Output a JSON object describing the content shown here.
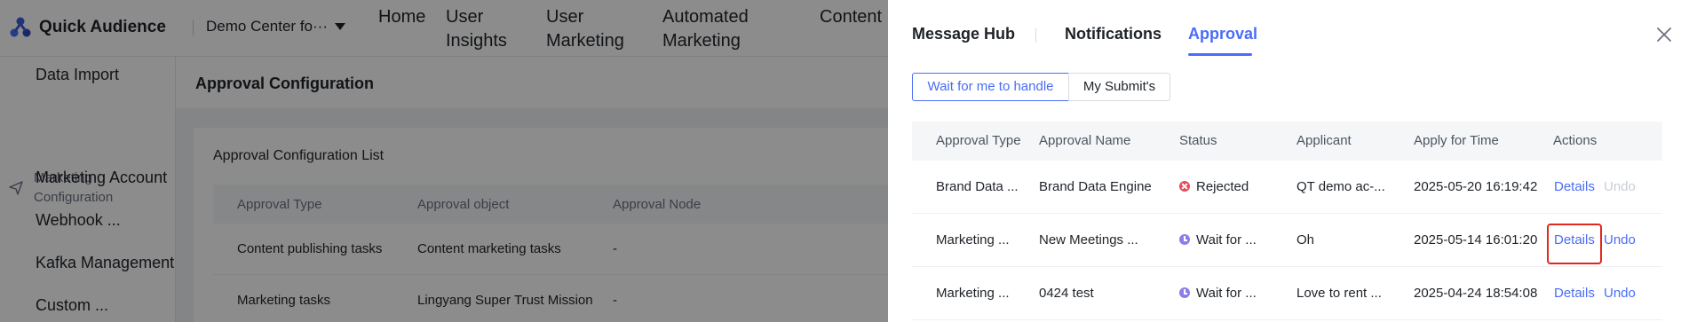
{
  "app": {
    "name": "Quick Audience",
    "org": "Demo Center fo···",
    "nav": [
      "Home",
      "User\nInsights",
      "User\nMarketing",
      "Automated\nMarketing",
      "Content"
    ],
    "sidebar": {
      "top_item": "Data Import",
      "group_label": "Marketing Configuration",
      "items": [
        "Marketing Account",
        "Webhook ...",
        "Kafka Management",
        "Custom ..."
      ]
    },
    "page_title": "Approval Configuration",
    "card_title": "Approval Configuration List",
    "table": {
      "headers": [
        "Approval Type",
        "Approval object",
        "Approval Node"
      ],
      "rows": [
        [
          "Content publishing tasks",
          "Content marketing tasks",
          "-"
        ],
        [
          "Marketing tasks",
          "Lingyang Super Trust Mission",
          "-"
        ]
      ]
    }
  },
  "drawer": {
    "tabs": [
      "Message Hub",
      "Notifications",
      "Approval"
    ],
    "active_tab": "Approval",
    "close_icon": "close-icon",
    "segments": [
      "Wait for me to handle",
      "My Submit's"
    ],
    "active_segment": "Wait for me to handle",
    "headers": [
      "Approval Type",
      "Approval Name",
      "Status",
      "Applicant",
      "Apply for Time",
      "Actions"
    ],
    "rows": [
      {
        "type": "Brand Data ...",
        "name": "Brand Data Engine",
        "status": "Rejected",
        "status_kind": "rejected",
        "applicant": "QT demo ac-...",
        "time": "2025-05-20 16:19:42",
        "details": "Details",
        "undo": "Undo",
        "undo_enabled": false
      },
      {
        "type": "Marketing ...",
        "name": "New Meetings ...",
        "status": "Wait for ...",
        "status_kind": "wait",
        "applicant": "Oh",
        "time": "2025-05-14 16:01:20",
        "details": "Details",
        "undo": "Undo",
        "undo_enabled": true
      },
      {
        "type": "Marketing ...",
        "name": "0424 test",
        "status": "Wait for ...",
        "status_kind": "wait",
        "applicant": "Love to rent ...",
        "time": "2025-04-24 18:54:08",
        "details": "Details",
        "undo": "Undo",
        "undo_enabled": true
      }
    ]
  },
  "colors": {
    "accent": "#4a6cf7",
    "rejected": "#e34d59",
    "waiting": "#8b7ee8",
    "highlight": "#e0291c"
  }
}
